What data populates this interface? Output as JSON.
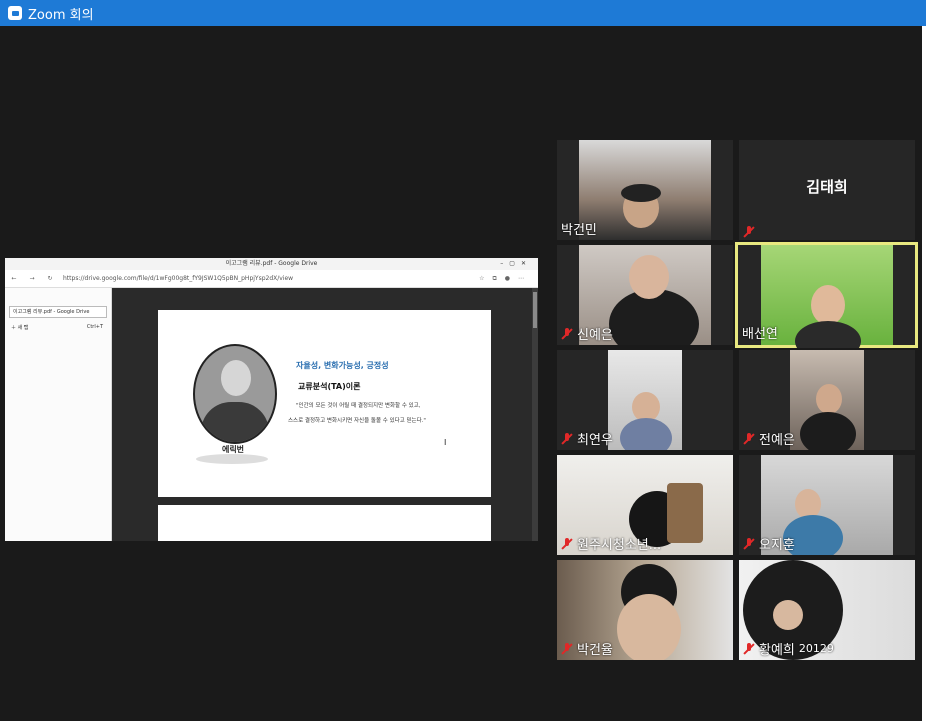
{
  "window": {
    "title": "Zoom 회의"
  },
  "share": {
    "browser_title": "이고그램 리뷰.pdf - Google Drive",
    "url": "https://drive.google.com/file/d/1wFg00g8t_fY9JSW1Q5pBN_pHpjYsp2dX/view",
    "sidebar_tab": "이고그램 리뷰.pdf - Google Drive",
    "sidebar_new": "새 탭",
    "sidebar_shortcut": "Ctrl+T",
    "slide": {
      "subtitle": "자율성, 변화가능성, 긍정성",
      "heading": "교류분석(TA)이론",
      "quote_line1": "\"인간의 모든 것이 어릴 때 결정되지만 변화할 수 있고,",
      "quote_line2": "스스로 결정하고 변화시키면 자신을 돌볼 수 있다고 믿는다.\"",
      "person_name": "에릭번"
    }
  },
  "participants": [
    {
      "name": "박건민",
      "muted": false,
      "video": true
    },
    {
      "name": "김태희",
      "muted": true,
      "video": false
    },
    {
      "name": "신예은",
      "muted": true,
      "video": true
    },
    {
      "name": "배선연",
      "muted": false,
      "video": true,
      "active_speaker": true
    },
    {
      "name": "최연우",
      "muted": true,
      "video": true
    },
    {
      "name": "전예은",
      "muted": true,
      "video": true
    },
    {
      "name": "원주시청소년...",
      "muted": true,
      "video": true
    },
    {
      "name": "오지훈",
      "muted": true,
      "video": true
    },
    {
      "name": "박건율",
      "muted": true,
      "video": true
    },
    {
      "name": "황예희",
      "muted": true,
      "video": true,
      "extra": "20129"
    }
  ],
  "colors": {
    "title_bar": "#1e7ad6",
    "muted_icon": "#e02828",
    "active_border": "#e8e880"
  }
}
